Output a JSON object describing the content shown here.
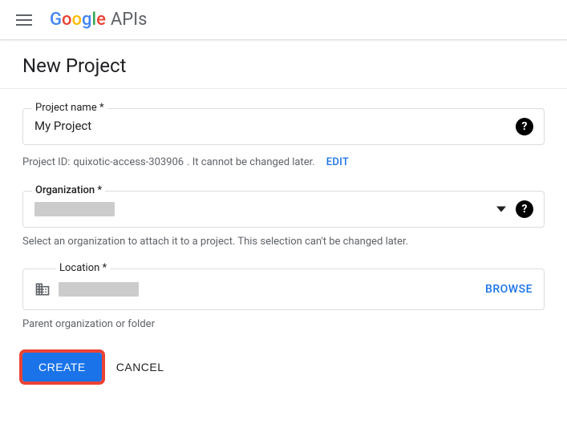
{
  "header": {
    "logo_apis": "APIs"
  },
  "page": {
    "title": "New Project"
  },
  "form": {
    "project_name": {
      "label": "Project name *",
      "value": "My Project"
    },
    "project_id": {
      "prefix": "Project ID: ",
      "id": "quixotic-access-303906",
      "suffix": ". It cannot be changed later.",
      "edit_label": "EDIT"
    },
    "organization": {
      "label": "Organization *",
      "help_text": "Select an organization to attach it to a project. This selection can't be changed later."
    },
    "location": {
      "label": "Location *",
      "browse_label": "BROWSE",
      "help_text": "Parent organization or folder"
    }
  },
  "buttons": {
    "create": "CREATE",
    "cancel": "CANCEL"
  }
}
